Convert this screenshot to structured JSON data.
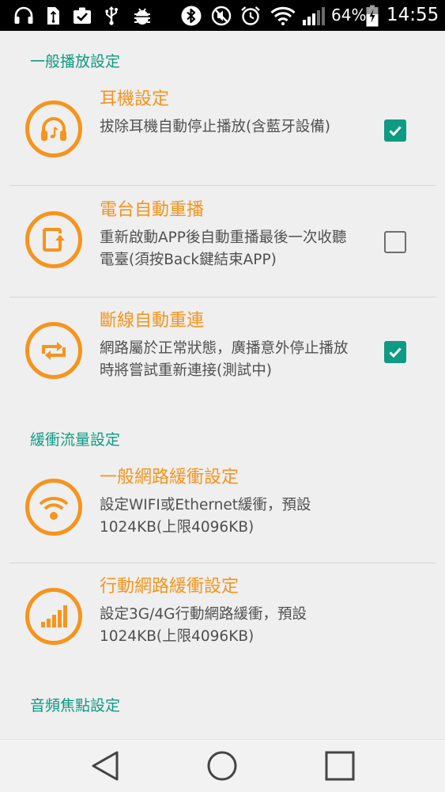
{
  "status_bar": {
    "icons": [
      "headset-icon",
      "usb-file-icon",
      "clipboard-check-icon",
      "usb-icon",
      "android-debug-icon",
      "bluetooth-icon",
      "mute-icon",
      "alarm-icon",
      "wifi-icon",
      "signal-icon"
    ],
    "battery": "64%",
    "time": "14:55"
  },
  "sections": [
    {
      "title": "一般播放設定"
    },
    {
      "title": "緩衝流量設定"
    },
    {
      "title": "音頻焦點設定"
    }
  ],
  "items": [
    {
      "title": "耳機設定",
      "desc": "拔除耳機自動停止播放(含藍牙設備)",
      "icon": "headphones-icon",
      "checked": true
    },
    {
      "title": "電台自動重播",
      "desc": "重新啟動APP後自動重播最後一次收聽電臺(須按Back鍵結束APP)",
      "icon": "replay-icon",
      "checked": false
    },
    {
      "title": "斷線自動重連",
      "desc": "網路屬於正常狀態，廣播意外停止播放時將嘗試重新連接(測試中)",
      "icon": "reconnect-icon",
      "checked": true
    },
    {
      "title": "一般網路緩衝設定",
      "desc": "設定WIFI或Ethernet緩衝，預設1024KB(上限4096KB)",
      "icon": "wifi-icon"
    },
    {
      "title": "行動網路緩衝設定",
      "desc": "設定3G/4G行動網路緩衝，預設1024KB(上限4096KB)",
      "icon": "cellular-signal-icon"
    }
  ],
  "colors": {
    "accent": "#f7941d",
    "section": "#0e9b83",
    "checkbox": "#0e9b83"
  },
  "nav_bar": {
    "buttons": [
      "back-icon",
      "home-icon",
      "recents-icon"
    ]
  }
}
